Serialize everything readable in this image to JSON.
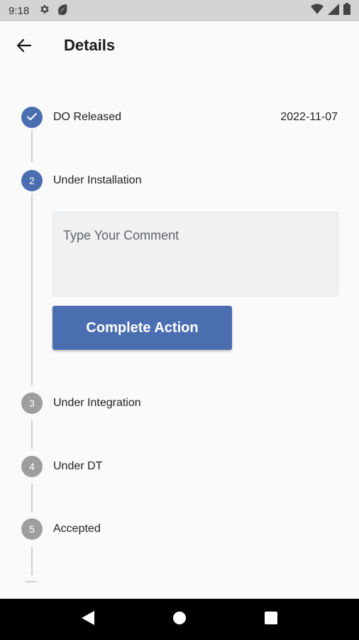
{
  "status_bar": {
    "time": "9:18",
    "icons_left": [
      "gear-icon",
      "leaf-icon"
    ],
    "icons_right": [
      "wifi-icon",
      "signal-icon",
      "battery-icon"
    ]
  },
  "app_bar": {
    "title": "Details",
    "back_icon": "arrow-left-icon"
  },
  "steps": [
    {
      "number": "1",
      "label": "DO Released",
      "date": "2022-11-07",
      "state": "completed"
    },
    {
      "number": "2",
      "label": "Under Installation",
      "date": "",
      "state": "active"
    },
    {
      "number": "3",
      "label": "Under Integration",
      "date": "",
      "state": "pending"
    },
    {
      "number": "4",
      "label": "Under DT",
      "date": "",
      "state": "pending"
    },
    {
      "number": "5",
      "label": "Accepted",
      "date": "",
      "state": "pending"
    }
  ],
  "comment": {
    "placeholder": "Type Your Comment",
    "value": ""
  },
  "complete_button": {
    "label": "Complete Action"
  },
  "colors": {
    "accent": "#4b6eb1",
    "inactive_step": "#9e9e9e",
    "status_bar": "#d4d4d4",
    "nav_bar": "#000000"
  },
  "nav_bar": {
    "buttons": [
      "back-triangle-icon",
      "home-circle-icon",
      "recents-square-icon"
    ]
  }
}
